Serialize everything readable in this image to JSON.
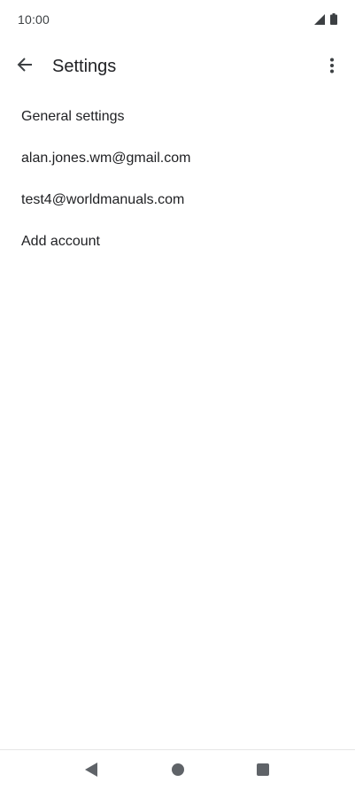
{
  "status_bar": {
    "time": "10:00",
    "icons": [
      "signal-icon",
      "battery-icon"
    ]
  },
  "app_bar": {
    "title": "Settings",
    "back_icon": "arrow-back-icon",
    "overflow_icon": "more-vert-icon"
  },
  "settings_list": {
    "items": [
      {
        "label": "General settings"
      },
      {
        "label": "alan.jones.wm@gmail.com"
      },
      {
        "label": "test4@worldmanuals.com"
      },
      {
        "label": "Add account"
      }
    ]
  },
  "nav_bar": {
    "icons": [
      "nav-back-icon",
      "nav-home-icon",
      "nav-recents-icon"
    ]
  },
  "colors": {
    "text_primary": "#202124",
    "status_text": "#3c4043",
    "nav_icon": "#5f6368",
    "background": "#ffffff"
  }
}
